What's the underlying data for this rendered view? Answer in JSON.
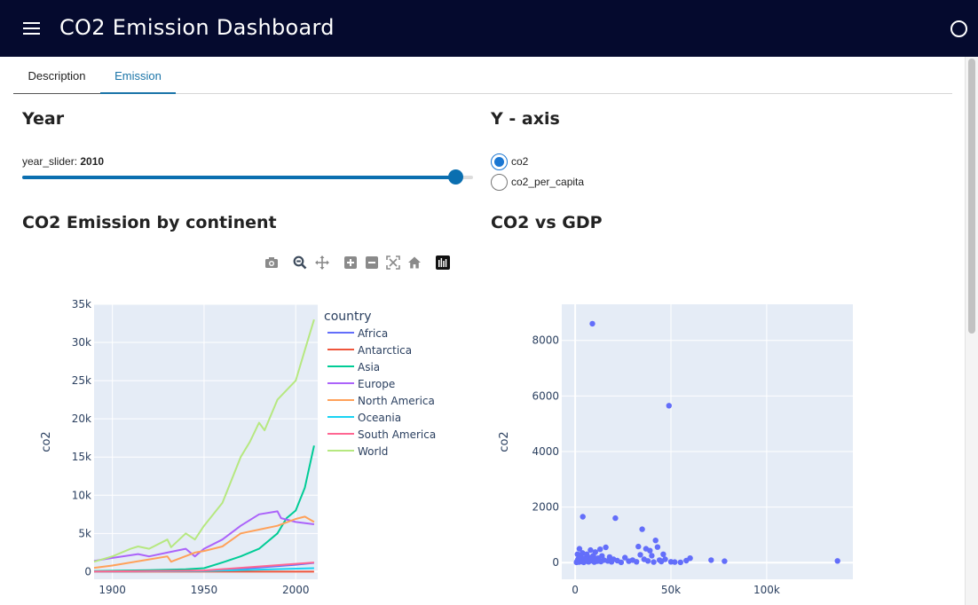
{
  "app": {
    "title": "CO2 Emission Dashboard",
    "menu_icon": "hamburger-menu-icon",
    "status_icon": "loading-ring-icon"
  },
  "tabs": [
    {
      "label": "Description",
      "active": false
    },
    {
      "label": "Emission",
      "active": true
    }
  ],
  "year_section": {
    "heading": "Year",
    "slider_name": "year_slider:",
    "slider_value": "2010",
    "slider_fraction": 0.96
  },
  "yaxis_section": {
    "heading": "Y - axis",
    "options": [
      {
        "label": "co2",
        "checked": true
      },
      {
        "label": "co2_per_capita",
        "checked": false
      }
    ]
  },
  "modebar": {
    "icons": [
      "camera-icon",
      "zoom-icon",
      "pan-icon",
      "zoom-in-icon",
      "zoom-out-icon",
      "autoscale-icon",
      "reset-axes-icon",
      "plotly-logo-icon"
    ]
  },
  "colors": {
    "accent": "#0b6fb0",
    "appbar": "#050a2e",
    "plot_bg": "#e5ecf6",
    "marker": "#636efa"
  },
  "chart_data": [
    {
      "type": "line",
      "title": "CO2 Emission by continent",
      "xlabel": "",
      "ylabel": "co2",
      "xlim": [
        1890,
        2012
      ],
      "ylim": [
        -1000,
        35000
      ],
      "xticks": [
        1900,
        1950,
        2000
      ],
      "xtick_labels": [
        "1900",
        "1950",
        "2000"
      ],
      "yticks": [
        0,
        5000,
        10000,
        15000,
        20000,
        25000,
        30000,
        35000
      ],
      "ytick_labels": [
        "0",
        "5k",
        "10k",
        "15k",
        "20k",
        "25k",
        "30k",
        "35k"
      ],
      "legend_title": "country",
      "legend_position": "right",
      "series": [
        {
          "name": "Africa",
          "color": "#636efa",
          "x": [
            1890,
            1920,
            1950,
            1980,
            2000,
            2010
          ],
          "y": [
            10,
            40,
            120,
            550,
            900,
            1150
          ]
        },
        {
          "name": "Antarctica",
          "color": "#ef553b",
          "x": [
            1890,
            2010
          ],
          "y": [
            0,
            0
          ]
        },
        {
          "name": "Asia",
          "color": "#00cc96",
          "x": [
            1890,
            1920,
            1940,
            1950,
            1960,
            1970,
            1980,
            1990,
            1995,
            2000,
            2005,
            2010
          ],
          "y": [
            80,
            200,
            300,
            450,
            1200,
            2000,
            3000,
            5000,
            7000,
            8000,
            11000,
            16500
          ]
        },
        {
          "name": "Europe",
          "color": "#ab63fa",
          "x": [
            1890,
            1900,
            1914,
            1920,
            1930,
            1940,
            1945,
            1950,
            1960,
            1970,
            1980,
            1990,
            1992,
            2000,
            2010
          ],
          "y": [
            1400,
            1800,
            2300,
            2000,
            2500,
            3000,
            2000,
            3000,
            4200,
            6000,
            7500,
            7900,
            7000,
            6500,
            6200
          ]
        },
        {
          "name": "North America",
          "color": "#ffa15a",
          "x": [
            1890,
            1900,
            1920,
            1930,
            1932,
            1945,
            1950,
            1960,
            1970,
            1980,
            1990,
            2000,
            2005,
            2010
          ],
          "y": [
            500,
            800,
            1600,
            2000,
            1300,
            2500,
            2700,
            3300,
            5000,
            5500,
            6000,
            6900,
            7200,
            6500
          ]
        },
        {
          "name": "Oceania",
          "color": "#19d3f3",
          "x": [
            1890,
            1950,
            2010
          ],
          "y": [
            10,
            80,
            450
          ]
        },
        {
          "name": "South America",
          "color": "#ff6692",
          "x": [
            1890,
            1950,
            2010
          ],
          "y": [
            15,
            150,
            1200
          ]
        },
        {
          "name": "World",
          "color": "#b6e880",
          "x": [
            1890,
            1900,
            1910,
            1914,
            1920,
            1930,
            1932,
            1940,
            1945,
            1950,
            1960,
            1970,
            1975,
            1980,
            1983,
            1990,
            2000,
            2005,
            2010
          ],
          "y": [
            1300,
            2000,
            3000,
            3300,
            3000,
            4200,
            3200,
            5000,
            4200,
            6000,
            9000,
            15000,
            17000,
            19500,
            18500,
            22500,
            25000,
            29000,
            33000
          ]
        }
      ]
    },
    {
      "type": "scatter",
      "title": "CO2 vs GDP",
      "xlabel": "",
      "ylabel": "co2",
      "xlim": [
        -7000,
        145000
      ],
      "ylim": [
        -600,
        9300
      ],
      "xticks": [
        0,
        50000,
        100000
      ],
      "xtick_labels": [
        "0",
        "50k",
        "100k"
      ],
      "yticks": [
        0,
        2000,
        4000,
        6000,
        8000
      ],
      "ytick_labels": [
        "0",
        "2000",
        "4000",
        "6000",
        "8000"
      ],
      "color": "#636efa",
      "points": [
        [
          9000,
          8600
        ],
        [
          49000,
          5650
        ],
        [
          4000,
          1650
        ],
        [
          21000,
          1600
        ],
        [
          35000,
          1200
        ],
        [
          42000,
          800
        ],
        [
          1000,
          50
        ],
        [
          1500,
          120
        ],
        [
          2000,
          20
        ],
        [
          2500,
          80
        ],
        [
          3000,
          200
        ],
        [
          3500,
          40
        ],
        [
          4500,
          10
        ],
        [
          5000,
          150
        ],
        [
          5500,
          60
        ],
        [
          6000,
          300
        ],
        [
          6500,
          90
        ],
        [
          7000,
          30
        ],
        [
          7500,
          180
        ],
        [
          8000,
          450
        ],
        [
          8500,
          70
        ],
        [
          9500,
          250
        ],
        [
          10000,
          20
        ],
        [
          10500,
          380
        ],
        [
          11000,
          100
        ],
        [
          11500,
          50
        ],
        [
          12000,
          160
        ],
        [
          13000,
          480
        ],
        [
          13500,
          40
        ],
        [
          14000,
          240
        ],
        [
          15000,
          90
        ],
        [
          16000,
          550
        ],
        [
          17000,
          60
        ],
        [
          18000,
          200
        ],
        [
          19000,
          30
        ],
        [
          20000,
          120
        ],
        [
          22000,
          70
        ],
        [
          24000,
          10
        ],
        [
          26000,
          180
        ],
        [
          28000,
          50
        ],
        [
          30000,
          90
        ],
        [
          32000,
          30
        ],
        [
          33000,
          580
        ],
        [
          34000,
          280
        ],
        [
          36000,
          120
        ],
        [
          37000,
          500
        ],
        [
          38000,
          60
        ],
        [
          39000,
          430
        ],
        [
          40000,
          250
        ],
        [
          41000,
          20
        ],
        [
          43000,
          560
        ],
        [
          44000,
          90
        ],
        [
          45000,
          40
        ],
        [
          46000,
          300
        ],
        [
          47000,
          120
        ],
        [
          50000,
          30
        ],
        [
          52000,
          20
        ],
        [
          55000,
          10
        ],
        [
          58000,
          70
        ],
        [
          60000,
          160
        ],
        [
          71000,
          90
        ],
        [
          78000,
          50
        ],
        [
          137000,
          60
        ],
        [
          700,
          10
        ],
        [
          1200,
          300
        ],
        [
          2200,
          500
        ],
        [
          3800,
          350
        ],
        [
          6200,
          120
        ],
        [
          8800,
          200
        ],
        [
          12500,
          60
        ]
      ]
    }
  ]
}
